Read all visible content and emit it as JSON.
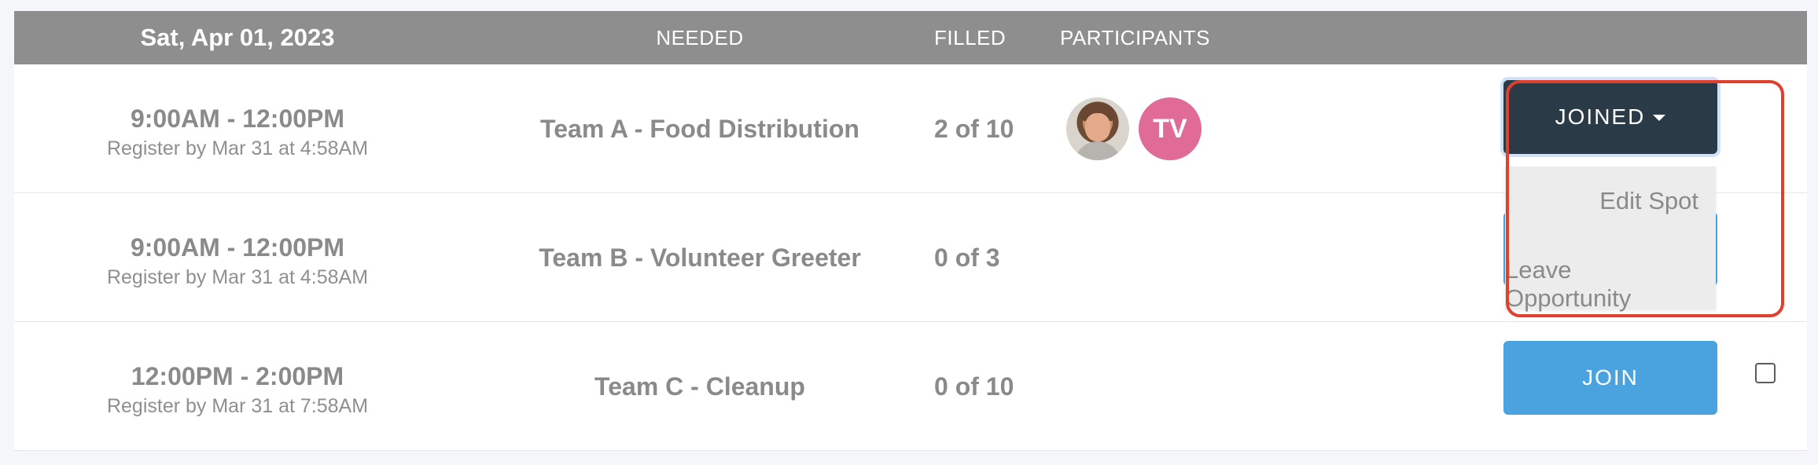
{
  "header": {
    "date": "Sat, Apr 01, 2023",
    "needed": "NEEDED",
    "filled": "FILLED",
    "participants": "PARTICIPANTS"
  },
  "rows": [
    {
      "time": "9:00AM - 12:00PM",
      "register_by": "Register by Mar 31 at 4:58AM",
      "needed": "Team A - Food Distribution",
      "filled": "2 of 10",
      "participants": [
        {
          "type": "photo",
          "icon": "user-photo-avatar"
        },
        {
          "type": "initials",
          "initials": "TV",
          "color": "#e06b96"
        }
      ],
      "action_label": "JOINED"
    },
    {
      "time": "9:00AM - 12:00PM",
      "register_by": "Register by Mar 31 at 4:58AM",
      "needed": "Team B - Volunteer Greeter",
      "filled": "0 of 3"
    },
    {
      "time": "12:00PM - 2:00PM",
      "register_by": "Register by Mar 31 at 7:58AM",
      "needed": "Team C - Cleanup",
      "filled": "0 of 10",
      "action_label": "JOIN"
    }
  ],
  "dropdown": {
    "items": [
      "Edit Spot",
      "Leave Opportunity"
    ]
  },
  "colors": {
    "header_bg": "#8e8e8e",
    "joined_button": "#2b3a47",
    "join_button": "#4aa3df",
    "highlight_border": "#e0402e"
  }
}
